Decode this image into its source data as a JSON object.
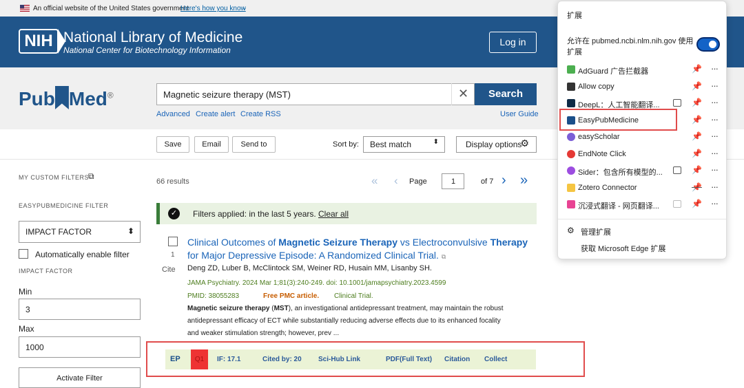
{
  "gov_banner": {
    "text": "An official website of the United States government",
    "link": "Here's how you know"
  },
  "header": {
    "logo": "NIH",
    "title": "National Library of Medicine",
    "subtitle": "National Center for Biotechnology Information",
    "login_label": "Log in"
  },
  "pubmed": {
    "logo_pub": "Pub",
    "logo_med": "Med",
    "reg": "®"
  },
  "search": {
    "value": "Magnetic seizure therapy (MST)",
    "button": "Search",
    "clear": "✕",
    "links": [
      "Advanced",
      "Create alert",
      "Create RSS"
    ],
    "guide": "User Guide"
  },
  "toolbar": {
    "save": "Save",
    "email": "Email",
    "send_to": "Send to",
    "sort_label": "Sort by:",
    "sort_value": "Best match",
    "display_options": "Display options"
  },
  "sidebar": {
    "custom_filters": "MY CUSTOM FILTERS",
    "ep_filter": "EASYPUBMEDICINE FILTER",
    "select_value": "IMPACT FACTOR",
    "auto_enable": "Automatically enable filter",
    "if_label": "IMPACT FACTOR",
    "min_label": "Min",
    "min_value": "3",
    "max_label": "Max",
    "max_value": "1000",
    "activate": "Activate Filter"
  },
  "results": {
    "count": "66 results",
    "page_label": "Page",
    "page_value": "1",
    "of_pages": "of 7"
  },
  "filter_bar": {
    "text": "Filters applied: in the last 5 years.",
    "clear": "Clear all"
  },
  "article": {
    "number": "1",
    "cite": "Cite",
    "title_p1": "Clinical Outcomes of ",
    "title_b1": "Magnetic Seizure Therapy",
    "title_p2": " vs Electroconvulsive ",
    "title_b2": "Therapy",
    "title_line2": "for Major Depressive Episode: A Randomized Clinical Trial.",
    "authors": "Deng ZD, Luber B, McClintock SM, Weiner RD, Husain MM, Lisanby SH.",
    "journal": "JAMA Psychiatry. 2024 Mar 1;81(3):240-249. doi: 10.1001/jamapsychiatry.2023.4599",
    "pmid": "PMID: 38055283",
    "free_pmc": "Free PMC article.",
    "type": "Clinical Trial.",
    "snippet_b1": "Magnetic seizure therapy",
    "snippet_p1": " (",
    "snippet_b2": "MST",
    "snippet_p2": "), an investigational antidepressant treatment, may maintain the robust",
    "snippet_line2": "antidepressant efficacy of ECT while substantially reducing adverse effects due to its enhanced focality",
    "snippet_line3": "and weaker stimulation strength; however, prev ..."
  },
  "easypub_row": {
    "logo": "EP",
    "quartile": "Q1",
    "if": "IF:  17.1",
    "cited": "Cited by:  20",
    "scihub": "Sci-Hub Link",
    "pdf": "PDF(Full Text)",
    "citation": "Citation",
    "collect": "Collect"
  },
  "extensions_panel": {
    "title": "扩展",
    "allow_text": "允许在 pubmed.ncbi.nlm.nih.gov 使用扩展",
    "items": [
      {
        "name": "AdGuard 广告拦截器",
        "color": "#4caf50"
      },
      {
        "name": "Allow copy",
        "color": "#333333"
      },
      {
        "name": "DeepL：人工智能翻译...",
        "color": "#0f2b46"
      },
      {
        "name": "EasyPubMedicine",
        "color": "#1a4f8a"
      },
      {
        "name": "easyScholar",
        "color": "#7b5ed6"
      },
      {
        "name": "EndNote Click",
        "color": "#e53935"
      },
      {
        "name": "Sider：包含所有模型的...",
        "color": "#9c4de0"
      },
      {
        "name": "Zotero Connector",
        "color": "#f5c542"
      },
      {
        "name": "沉浸式翻译 - 网页翻译...",
        "color": "#e84393"
      }
    ],
    "manage": "管理扩展",
    "get_more": "获取 Microsoft Edge 扩展"
  }
}
